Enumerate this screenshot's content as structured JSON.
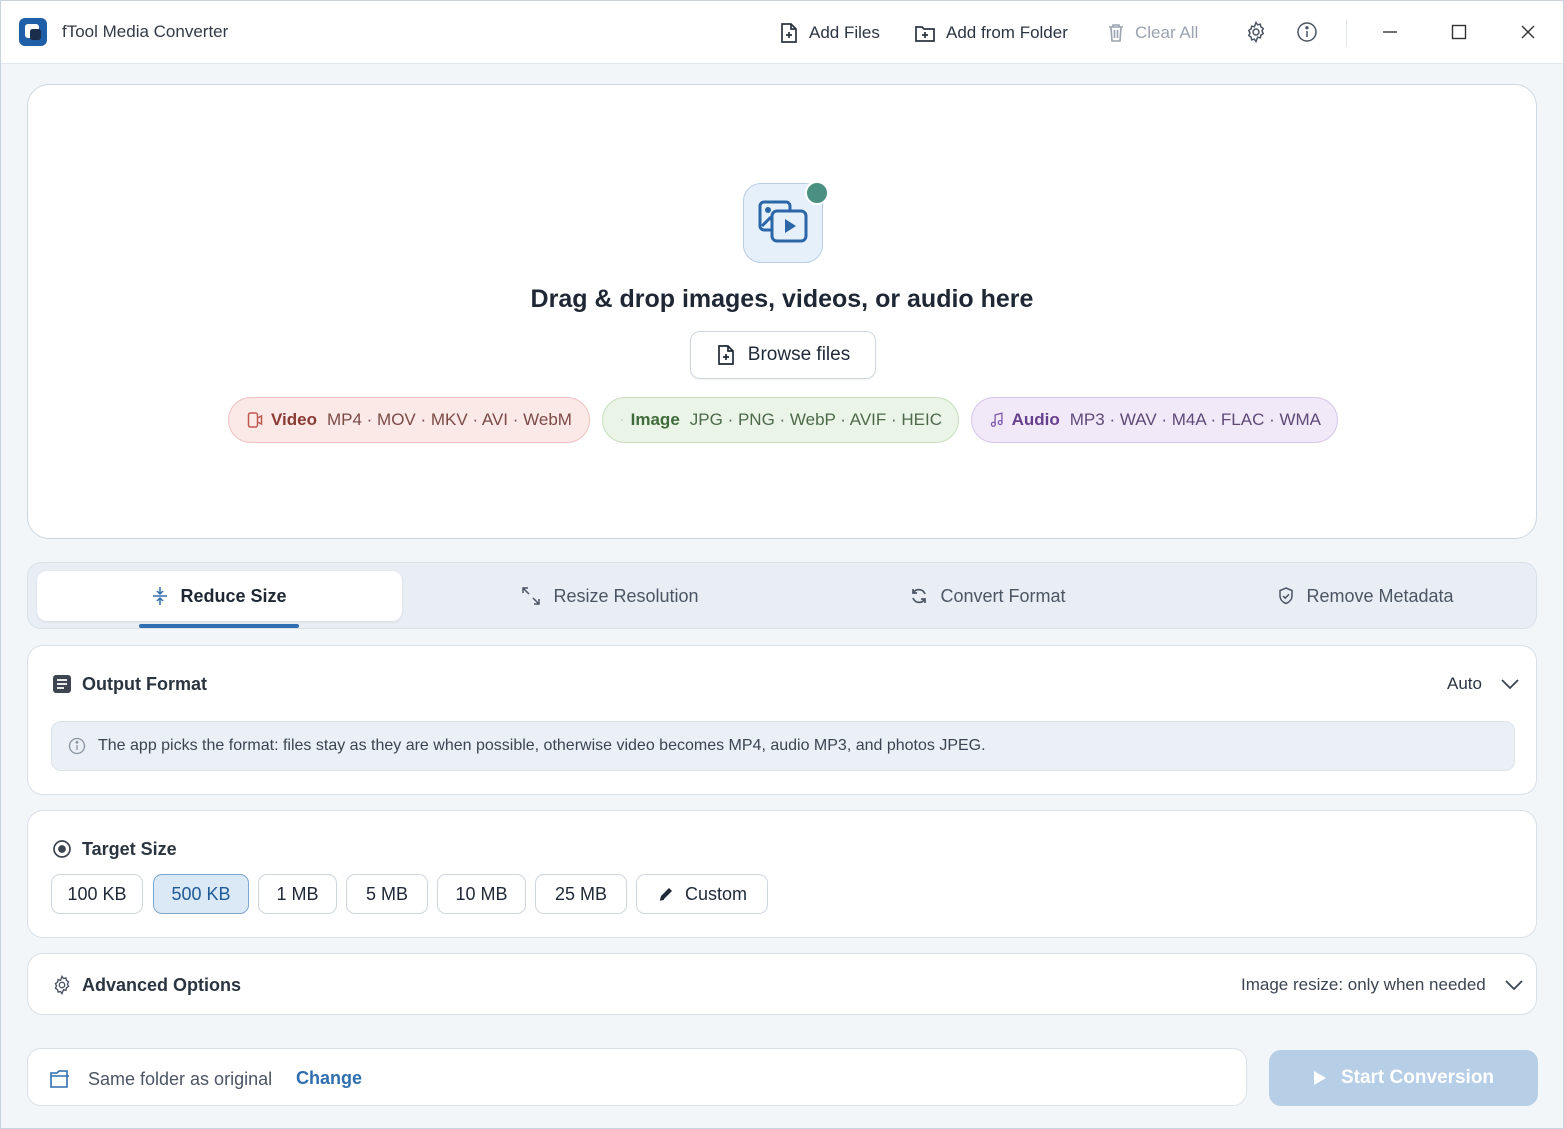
{
  "titlebar": {
    "app_title": "fTool Media Converter",
    "add_files": "Add Files",
    "add_from_folder": "Add from Folder",
    "clear_all": "Clear All",
    "icons": [
      "settings-icon",
      "info-icon",
      "minimize-icon",
      "maximize-icon",
      "close-icon"
    ]
  },
  "dropzone": {
    "title": "Drag & drop images, videos, or audio here",
    "browse_label": "Browse files",
    "chips": [
      {
        "name": "Video",
        "formats": "MP4 · MOV · MKV · AVI · WebM",
        "color": "#8a3a34"
      },
      {
        "name": "Image",
        "formats": "JPG · PNG · WebP · AVIF · HEIC",
        "color": "#3f6b3b"
      },
      {
        "name": "Audio",
        "formats": "MP3 · WAV · M4A · FLAC · WMA",
        "color": "#673f8f"
      }
    ],
    "status_dot_color": "#4a8f7f"
  },
  "tabs": [
    {
      "label": "Reduce Size",
      "active": true
    },
    {
      "label": "Resize Resolution",
      "active": false
    },
    {
      "label": "Convert Format",
      "active": false
    },
    {
      "label": "Remove Metadata",
      "active": false
    }
  ],
  "output_format": {
    "title": "Output Format",
    "value": "Auto",
    "info": "The app picks the format: files stay as they are when possible, otherwise video becomes MP4, audio MP3, and photos JPEG."
  },
  "target_size": {
    "title": "Target Size",
    "options": [
      "100 KB",
      "500 KB",
      "1 MB",
      "5 MB",
      "10 MB",
      "25 MB",
      "Custom"
    ],
    "selected": "500 KB"
  },
  "advanced": {
    "title": "Advanced Options",
    "summary": "Image resize: only when needed"
  },
  "footer": {
    "destination": "Same folder as original",
    "change_label": "Change",
    "start_label": "Start Conversion"
  },
  "colors": {
    "accent": "#2f6fb0",
    "start_button_disabled": "#b6cee6"
  }
}
